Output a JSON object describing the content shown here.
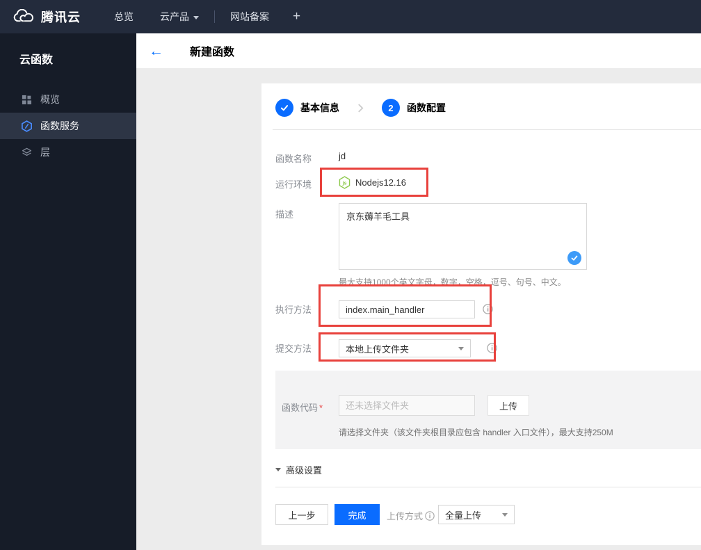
{
  "topbar": {
    "brand": "腾讯云",
    "items": [
      {
        "label": "总览"
      },
      {
        "label": "云产品"
      },
      {
        "label": "网站备案"
      }
    ],
    "plus": "+"
  },
  "sidebar": {
    "title": "云函数",
    "items": [
      {
        "label": "概览",
        "icon": "grid-icon",
        "active": false
      },
      {
        "label": "函数服务",
        "icon": "function-hexagon-icon",
        "active": true
      },
      {
        "label": "层",
        "icon": "layers-icon",
        "active": false
      }
    ]
  },
  "header": {
    "back": "←",
    "title": "新建函数"
  },
  "steps": {
    "step1": {
      "label": "基本信息",
      "state": "done",
      "icon": "check-circle-icon"
    },
    "step2": {
      "label": "函数配置",
      "number": "2",
      "state": "current"
    }
  },
  "form": {
    "name": {
      "label": "函数名称",
      "value": "jd"
    },
    "runtime": {
      "label": "运行环境",
      "value": "Nodejs12.16",
      "icon": "nodejs-icon"
    },
    "description": {
      "label": "描述",
      "value": "京东薅羊毛工具",
      "hint": "最大支持1000个英文字母，数字，空格，逗号、句号、中文。"
    },
    "handler": {
      "label": "执行方法",
      "value": "index.main_handler"
    },
    "submit_method": {
      "label": "提交方法",
      "value": "本地上传文件夹"
    },
    "code": {
      "label": "函数代码",
      "required_mark": "*",
      "placeholder": "还未选择文件夹",
      "upload_button": "上传",
      "hint": "请选择文件夹（该文件夹根目录应包含 handler 入口文件），最大支持250M"
    }
  },
  "advanced": {
    "label": "高级设置"
  },
  "footer": {
    "prev_button": "上一步",
    "finish_button": "完成",
    "upload_mode_label": "上传方式",
    "upload_mode_value": "全量上传"
  },
  "colors": {
    "topbar_bg": "#232b3c",
    "sidebar_bg": "#161c28",
    "sidebar_active_bg": "#2d3545",
    "accent_blue": "#0a6cff",
    "bubble_blue": "#3d9bf8",
    "annotation_red": "#e8413c",
    "nodejs_green": "#8cc84b",
    "content_bg": "#ececec",
    "code_section_bg": "#f3f3f4"
  }
}
